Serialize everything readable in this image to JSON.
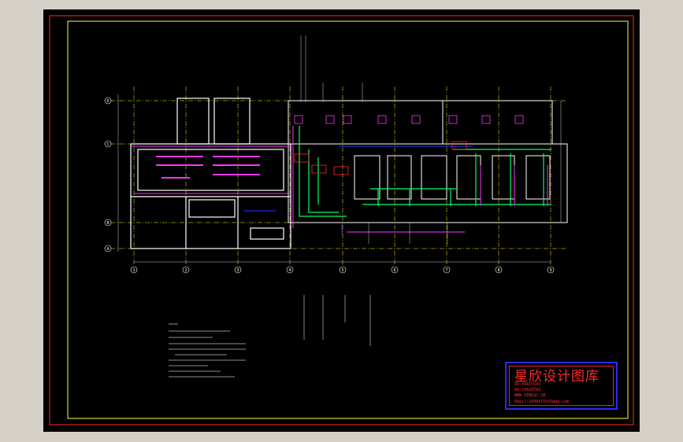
{
  "drawing": {
    "grid_rows": [
      "D",
      "C",
      "B",
      "A"
    ],
    "grid_cols": [
      "1",
      "2",
      "3",
      "4",
      "5",
      "6",
      "7",
      "8",
      "9"
    ]
  },
  "title_block": {
    "title": "星欣设计图库",
    "lines": [
      "QQ:49415543",
      "QQ:19829783",
      "WWW.XINGSC.CN",
      "Email:1049415543@qq.com"
    ]
  },
  "colors": {
    "background": "#000000",
    "frame_outer": "#ff2a2a",
    "frame_inner": "#ffff33",
    "wall": "#ffffff",
    "duct": "#00ff66",
    "pipe": "#ff33ff",
    "grid": "#ffff00",
    "accent": "#3030ff"
  }
}
